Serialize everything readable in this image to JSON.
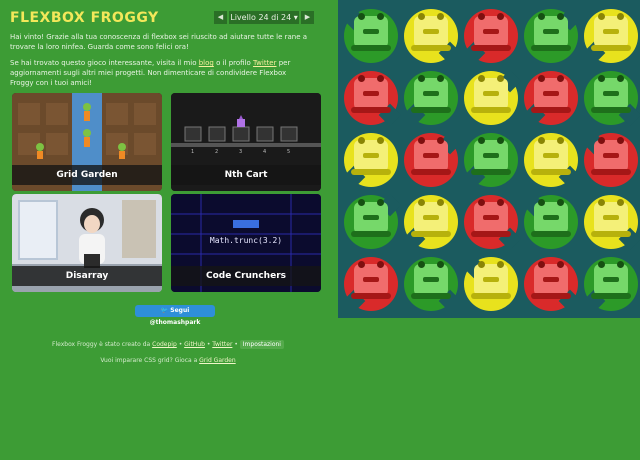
{
  "app": {
    "title": "FLEXBOX FROGGY"
  },
  "level_nav": {
    "prev": "◀",
    "level_text": "Livello 24 di 24 ▾",
    "next": "▶"
  },
  "intro": {
    "para1": "Hai vinto! Grazie alla tua conoscenza di flexbox sei riuscito ad aiutare tutte le rane a trovare la loro ninfea. Guarda come sono felici ora!",
    "para2_a": "Se hai trovato questo gioco interessante, visita il mio ",
    "blog_link": "blog",
    "para2_b": " o il profilo ",
    "twitter_link": "Twitter",
    "para2_c": " per aggiornamenti sugli altri miei progetti. Non dimenticare di condividere Flexbox Froggy con i tuoi amici!"
  },
  "games": [
    {
      "label": "Grid Garden"
    },
    {
      "label": "Nth Cart"
    },
    {
      "label": "Disarray"
    },
    {
      "label": "Code Crunchers",
      "code": "Math.trunc(3.2)"
    }
  ],
  "social": {
    "follow_label": "Segui @thomashpark"
  },
  "footer": {
    "line1_a": "Flexbox Froggy è stato creato da ",
    "codepip": "Codepip",
    "sep1": " • ",
    "github": "GitHub",
    "sep2": " • ",
    "twitter": "Twitter",
    "sep3": " • ",
    "lang": "Impostazioni",
    "line2_a": "Vuoi imparare CSS grid? Gioca a ",
    "grid_garden": "Grid Garden"
  },
  "colors": {
    "background": "#3d9c35",
    "board": "#1b5b5f",
    "title": "#f3e85a",
    "red": "#e02a2a",
    "yellow": "#ecea1a",
    "green": "#2e9e2a"
  },
  "board_rows": [
    [
      "green",
      "yellow",
      "red",
      "green",
      "yellow"
    ],
    [
      "red",
      "green",
      "yellow",
      "red",
      "green"
    ],
    [
      "yellow",
      "red",
      "green",
      "yellow",
      "red"
    ],
    [
      "green",
      "yellow",
      "red",
      "green",
      "yellow"
    ],
    [
      "red",
      "green",
      "yellow",
      "red",
      "green"
    ]
  ]
}
